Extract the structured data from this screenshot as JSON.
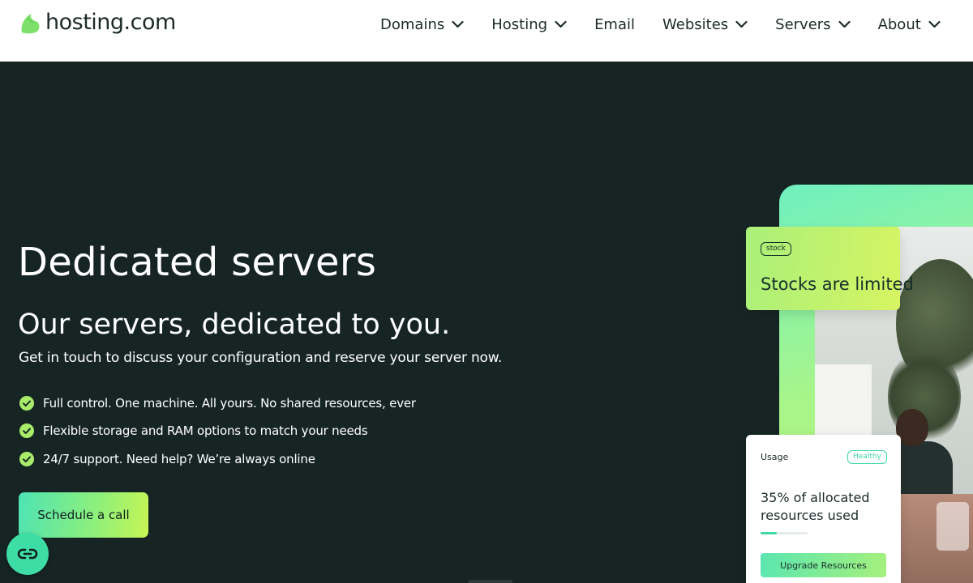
{
  "header": {
    "logo_text": "hosting.com",
    "nav": [
      {
        "label": "Domains",
        "has_dropdown": true
      },
      {
        "label": "Hosting",
        "has_dropdown": true
      },
      {
        "label": "Email",
        "has_dropdown": false
      },
      {
        "label": "Websites",
        "has_dropdown": true
      },
      {
        "label": "Servers",
        "has_dropdown": true
      },
      {
        "label": "About",
        "has_dropdown": true
      }
    ]
  },
  "hero": {
    "title": "Dedicated servers",
    "subtitle": "Our servers, dedicated to you.",
    "description": "Get in touch to discuss your configuration and reserve your server now.",
    "features": [
      "Full control. One machine. All yours. No shared resources, ever",
      "Flexible storage and RAM options to match your needs",
      "24/7 support. Need help? We’re always online"
    ],
    "cta_label": "Schedule a call"
  },
  "stock_card": {
    "badge": "stock",
    "text": "Stocks are limited"
  },
  "usage_card": {
    "label": "Usage",
    "status_badge": "Healthy",
    "text": "35% of allocated resources used",
    "usage_percent": 35,
    "button_label": "Upgrade Resources"
  },
  "icons": {
    "logo": "leaf-logo-icon",
    "dropdown": "chevron-down-icon",
    "feature_check": "check-circle-icon",
    "chat": "chat-widget-icon"
  },
  "colors": {
    "background": "#162524",
    "accent_green": "#3dd9a7",
    "accent_lime": "#c8f553",
    "check": "#a8ec6a"
  }
}
